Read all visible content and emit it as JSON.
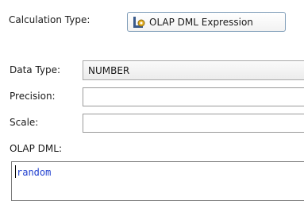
{
  "labels": {
    "calculation_type": "Calculation Type:",
    "data_type": "Data Type:",
    "precision": "Precision:",
    "scale": "Scale:",
    "olap_dml": "OLAP DML:"
  },
  "calculation_type": {
    "value": "OLAP DML Expression",
    "icon": "olap-dml-expression-icon"
  },
  "data_type": {
    "value": "NUMBER"
  },
  "precision": {
    "value": ""
  },
  "scale": {
    "value": ""
  },
  "olap_dml": {
    "value": "random",
    "text_color": "#1f3fcf"
  }
}
